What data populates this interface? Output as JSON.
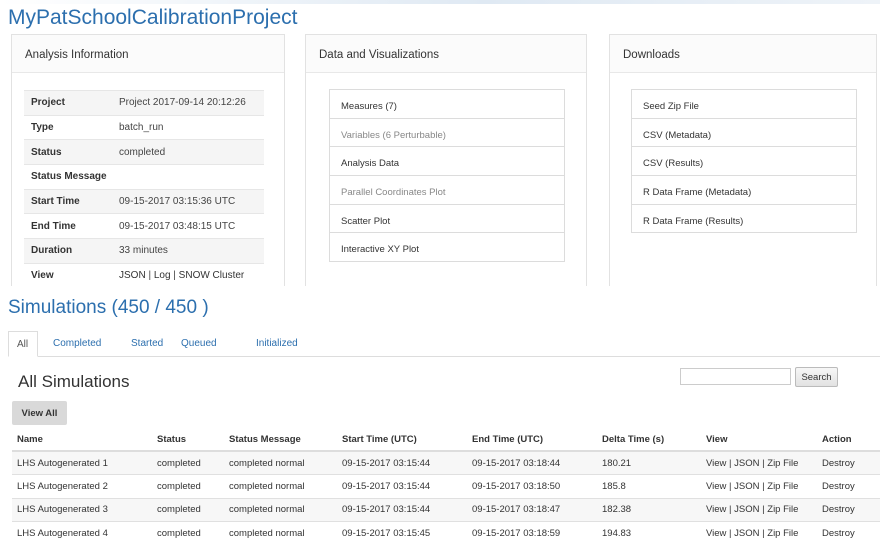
{
  "project_title": "MyPatSchoolCalibrationProject",
  "analysis_panel": {
    "heading": "Analysis Information",
    "rows": [
      {
        "key": "Project",
        "value": "Project 2017-09-14 20:12:26"
      },
      {
        "key": "Type",
        "value": "batch_run"
      },
      {
        "key": "Status",
        "value": "completed"
      },
      {
        "key": "Status Message",
        "value": ""
      },
      {
        "key": "Start Time",
        "value": "09-15-2017 03:15:36 UTC"
      },
      {
        "key": "End Time",
        "value": "09-15-2017 03:48:15 UTC"
      },
      {
        "key": "Duration",
        "value": "33 minutes"
      }
    ],
    "view_row": {
      "key": "View",
      "links": [
        "JSON",
        "Log",
        "SNOW Cluster"
      ],
      "separator": " | "
    }
  },
  "data_panel": {
    "heading": "Data and Visualizations",
    "items": [
      {
        "label": "Measures (7)"
      },
      {
        "label": "Variables (6 Perturbable)"
      },
      {
        "label": "Analysis Data"
      },
      {
        "label": "Parallel Coordinates Plot"
      },
      {
        "label": "Scatter Plot"
      },
      {
        "label": "Interactive XY Plot"
      }
    ]
  },
  "downloads_panel": {
    "heading": "Downloads",
    "items": [
      {
        "label": "Seed Zip File"
      },
      {
        "label": "CSV (Metadata)"
      },
      {
        "label": "CSV (Results)"
      },
      {
        "label": "R Data Frame (Metadata)"
      },
      {
        "label": "R Data Frame (Results)"
      }
    ]
  },
  "simulations": {
    "title": "Simulations (450 / 450 )",
    "tabs": [
      "All",
      "Completed",
      "Started",
      "Queued",
      "Initialized"
    ],
    "active_tab": "All",
    "section_title": "All Simulations",
    "search": {
      "value": "",
      "button_label": "Search"
    },
    "view_all_label": "View All",
    "columns": [
      "Name",
      "Status",
      "Status Message",
      "Start Time (UTC)",
      "End Time (UTC)",
      "Delta Time (s)",
      "View",
      "Action"
    ],
    "rows": [
      {
        "name": "LHS Autogenerated 1",
        "status": "completed",
        "message": "completed normal",
        "start": "09-15-2017 03:15:44",
        "end": "09-15-2017 03:18:44",
        "delta": "180.21"
      },
      {
        "name": "LHS Autogenerated 2",
        "status": "completed",
        "message": "completed normal",
        "start": "09-15-2017 03:15:44",
        "end": "09-15-2017 03:18:50",
        "delta": "185.8"
      },
      {
        "name": "LHS Autogenerated 3",
        "status": "completed",
        "message": "completed normal",
        "start": "09-15-2017 03:15:44",
        "end": "09-15-2017 03:18:47",
        "delta": "182.38"
      },
      {
        "name": "LHS Autogenerated 4",
        "status": "completed",
        "message": "completed normal",
        "start": "09-15-2017 03:15:45",
        "end": "09-15-2017 03:18:59",
        "delta": "194.83"
      }
    ],
    "view_links": [
      "View",
      "JSON",
      "Zip File"
    ],
    "action_label": "Destroy"
  },
  "colors": {
    "link": "#2c6fae",
    "title": "#2c6fae",
    "border": "#dddddd"
  }
}
